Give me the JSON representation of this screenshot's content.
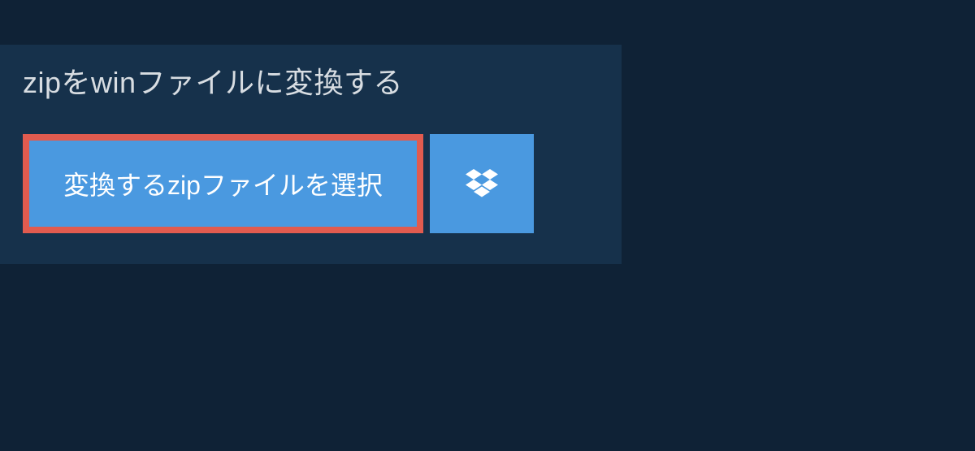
{
  "header": {
    "title": "zipをwinファイルに変換する"
  },
  "actions": {
    "select_file_label": "変換するzipファイルを選択",
    "dropbox_icon_name": "dropbox-icon"
  },
  "colors": {
    "background": "#0f2236",
    "panel": "#16314b",
    "button": "#4a99e0",
    "button_border": "#e15b4f",
    "text_light": "#d8dde2",
    "text_white": "#ffffff"
  }
}
